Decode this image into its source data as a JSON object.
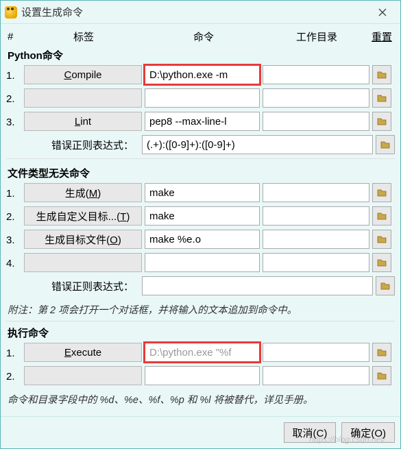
{
  "window": {
    "title": "设置生成命令"
  },
  "header": {
    "num": "#",
    "label": "标签",
    "cmd": "命令",
    "wd": "工作目录",
    "reset": "重置"
  },
  "sections": {
    "python": {
      "title": "Python命令",
      "rows": [
        {
          "num": "1.",
          "label_pre": "",
          "label_u": "C",
          "label_post": "ompile",
          "cmd": "D:\\python.exe -m",
          "wd": "",
          "red": true
        },
        {
          "num": "2.",
          "label_pre": "",
          "label_u": "",
          "label_post": "",
          "cmd": "",
          "wd": "",
          "red": false
        },
        {
          "num": "3.",
          "label_pre": "",
          "label_u": "L",
          "label_post": "int",
          "cmd": "pep8 --max-line-l",
          "wd": "",
          "red": false
        }
      ],
      "regex_label": "错误正则表达式：",
      "regex": "(.+):([0-9]+):([0-9]+)"
    },
    "filetype": {
      "title": "文件类型无关命令",
      "rows": [
        {
          "num": "1.",
          "label_pre": "生成(",
          "label_u": "M",
          "label_post": ")",
          "cmd": "make",
          "wd": ""
        },
        {
          "num": "2.",
          "label_pre": "生成自定义目标...(",
          "label_u": "T",
          "label_post": ")",
          "cmd": "make",
          "wd": ""
        },
        {
          "num": "3.",
          "label_pre": "生成目标文件(",
          "label_u": "O",
          "label_post": ")",
          "cmd": "make %e.o",
          "wd": ""
        },
        {
          "num": "4.",
          "label_pre": "",
          "label_u": "",
          "label_post": "",
          "cmd": "",
          "wd": ""
        }
      ],
      "regex_label": "错误正则表达式：",
      "regex": "",
      "note": "附注：第 2 项会打开一个对话框，并将输入的文本追加到命令中。"
    },
    "exec": {
      "title": "执行命令",
      "rows": [
        {
          "num": "1.",
          "label_pre": "",
          "label_u": "E",
          "label_post": "xecute",
          "cmd": "D:\\python.exe \"%f",
          "wd": "",
          "red": true,
          "placeholder": true
        },
        {
          "num": "2.",
          "label_pre": "",
          "label_u": "",
          "label_post": "",
          "cmd": "",
          "wd": "",
          "red": false
        }
      ],
      "note": "命令和目录字段中的 %d、%e、%f、%p 和 %l 将被替代，详见手册。"
    }
  },
  "footer": {
    "cancel": "取消(C)",
    "ok": "确定(O)"
  },
  "watermark": "https://blog.csdn.net/..."
}
